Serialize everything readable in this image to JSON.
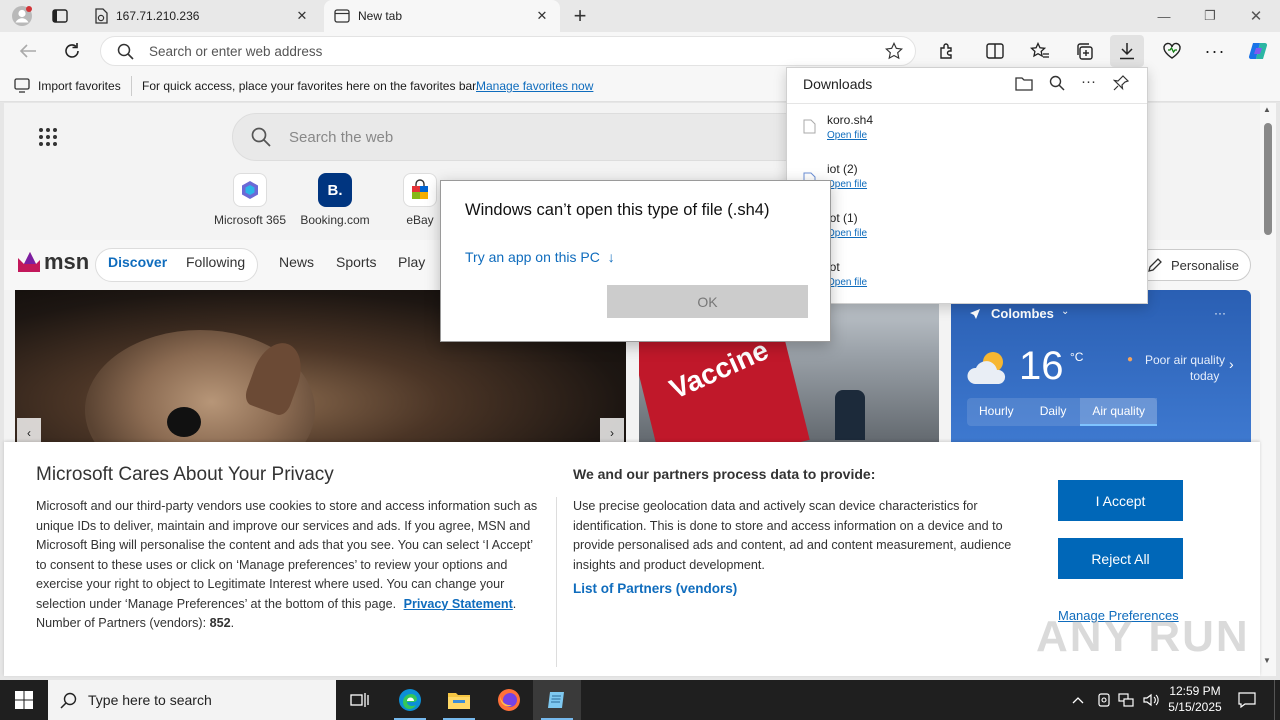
{
  "browser": {
    "tabs": [
      {
        "title": "167.71.210.236",
        "close": "✕"
      },
      {
        "title": "New tab",
        "close": "✕"
      }
    ],
    "new_tab": "+",
    "address_placeholder": "Search or enter web address",
    "window_controls": {
      "minimize": "—",
      "restore": "❐",
      "close": "✕"
    }
  },
  "favorites_bar": {
    "import_label": "Import favorites",
    "hint": "For quick access, place your favorites here on the favorites bar.",
    "manage_link": "Manage favorites now"
  },
  "msn": {
    "search_placeholder": "Search the web",
    "tiles": [
      {
        "label": "Microsoft 365",
        "color": "#6b69d6"
      },
      {
        "label": "Booking.com",
        "color": "#003580",
        "glyph": "B."
      },
      {
        "label": "eBay",
        "color": "#e53238"
      }
    ],
    "logo_text": "msn",
    "nav": {
      "discover": "Discover",
      "following": "Following",
      "news": "News",
      "sports": "Sports",
      "play": "Play"
    },
    "personalise": "Personalise",
    "hero_text": "Vaccine",
    "weather": {
      "location": "Colombes",
      "temperature": "16",
      "unit": "°C",
      "air_quality": "Poor air quality",
      "air_quality_when": "today",
      "tabs": [
        "Hourly",
        "Daily",
        "Air quality"
      ],
      "more": "···"
    }
  },
  "dialog": {
    "title": "Windows can’t open this type of file (.sh4)",
    "try_app": "Try an app on this PC",
    "try_app_arrow": "↓",
    "ok": "OK"
  },
  "downloads": {
    "title": "Downloads",
    "items": [
      {
        "name": "koro.sh4",
        "action": "Open file"
      },
      {
        "name": "iot (2)",
        "action": "Open file"
      },
      {
        "name": "iot (1)",
        "action": "Open file"
      },
      {
        "name": "iot",
        "action": "Open file"
      }
    ]
  },
  "privacy": {
    "title": "Microsoft Cares About Your Privacy",
    "body": "Microsoft and our third-party vendors use cookies to store and access information such as unique IDs to deliver, maintain and improve our services and ads. If you agree, MSN and Microsoft Bing will personalise the content and ads that you see. You can select ‘I Accept’ to consent to these uses or click on ‘Manage preferences’ to review your options and exercise your right to object to Legitimate Interest where used.  You can change your selection under ‘Manage Preferences’ at the bottom of this page.",
    "privacy_link": "Privacy Statement",
    "partners_label": "Number of Partners (vendors):",
    "partners_count": "852",
    "right_title": "We and our partners process data to provide:",
    "right_body": "Use precise geolocation data and actively scan device characteristics for identification. This is done to store and access information on a device and to provide personalised ads and content, ad and content measurement, audience insights and product development.",
    "partners_link": "List of Partners (vendors)",
    "accept": "I Accept",
    "reject": "Reject All",
    "manage": "Manage Preferences"
  },
  "taskbar": {
    "search_placeholder": "Type here to search",
    "time": "12:59 PM",
    "date": "5/15/2025"
  },
  "watermark": "ANY RUN",
  "colors": {
    "accent": "#0067b8",
    "link": "#0f6cbd",
    "taskbar": "#1f1f1f"
  }
}
